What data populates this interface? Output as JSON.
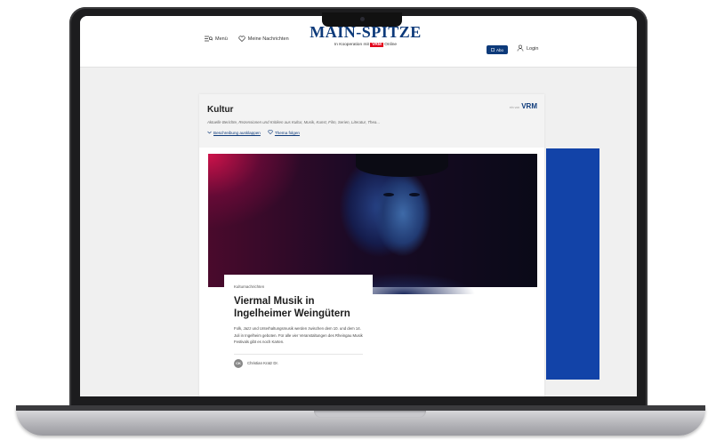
{
  "header": {
    "menu_label": "Menü",
    "watchlist_label": "Meine Nachrichten",
    "logo_title": "MAIN-SPITZE",
    "logo_subtitle_prefix": "In Kooperation mit",
    "logo_subtitle_badge": "VRM",
    "logo_subtitle_suffix": "Online",
    "abo_label": "Abo",
    "login_label": "Login"
  },
  "section": {
    "title": "Kultur",
    "brand_small": "ein von",
    "brand": "VRM",
    "description": "Aktuelle Berichte, Rezensionen und Kritiken aus Kultur, Musik, Kunst, Film, Serien, Literatur, Thea...",
    "expand_label": "Beschreibung ausklappen",
    "follow_label": "Thema folgen"
  },
  "article": {
    "kicker": "Kulturnachrichten",
    "headline": "Viermal Musik in Ingelheimer Weingütern",
    "summary": "Folk, Jazz und Unterhaltungsmusik werden zwischen dem 10. und dem 14. Juli in Ingelheim geboten. Für alle vier Veranstaltungen des Rheingau Musik Festivals gibt es noch Karten.",
    "author_initials": "CK",
    "author_name": "Christian Kratz Dr."
  },
  "colors": {
    "brand_blue": "#0d3a7a",
    "ad_blue": "#1243a8"
  }
}
